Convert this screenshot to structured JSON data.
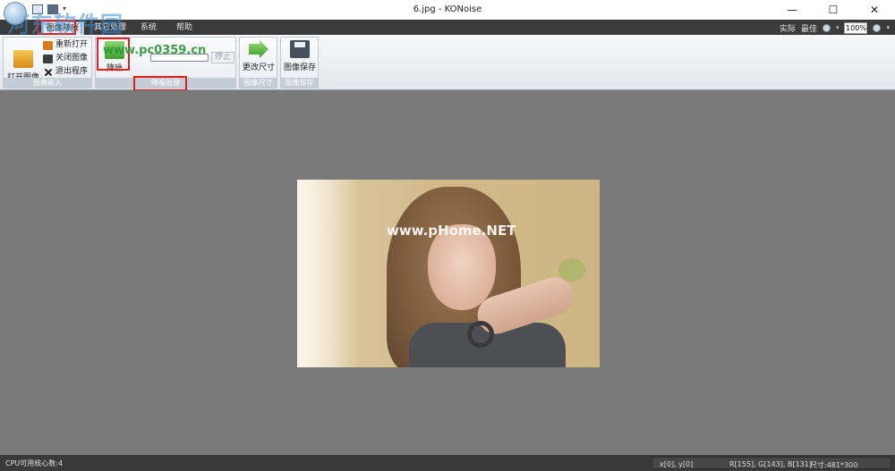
{
  "window": {
    "title": "6.jpg - KONoise",
    "minimize_symbol": "—",
    "maximize_symbol": "☐",
    "close_symbol": "✕"
  },
  "watermark": {
    "site_name": "河东软件园",
    "url": "www.pc0359.cn"
  },
  "menu": {
    "tabs": [
      "图像降噪",
      "其它处理",
      "系统",
      "帮助"
    ],
    "active_tab": "图像降噪"
  },
  "zoom": {
    "actual_label": "实际",
    "best_label": "最佳",
    "value": "100%"
  },
  "ribbon": {
    "groups": {
      "image_input": {
        "label": "图像输入",
        "open_label": "打开图像",
        "reopen_label": "重新打开",
        "close_label": "关闭图像",
        "exit_label": "退出程序"
      },
      "denoise": {
        "label": "降噪处理",
        "denoise_label": "降噪",
        "stop_label": "停止",
        "progress": 0
      },
      "resize": {
        "label": "图像尺寸",
        "button_label": "更改尺寸"
      },
      "save": {
        "label": "图像保存",
        "button_label": "图像保存"
      }
    }
  },
  "image": {
    "watermark_text": "www.pHome.NET"
  },
  "status": {
    "cpu": "CPU可用核心数:4",
    "coords": "x[0], y[0]",
    "rgb": "R[155], G[143], B[131]",
    "size": "尺寸:481*300"
  },
  "colors": {
    "highlight": "#e0201e",
    "menubar": "#3b3b3b",
    "canvas": "#7a7a7a",
    "statusbar": "#3a3a3a"
  }
}
